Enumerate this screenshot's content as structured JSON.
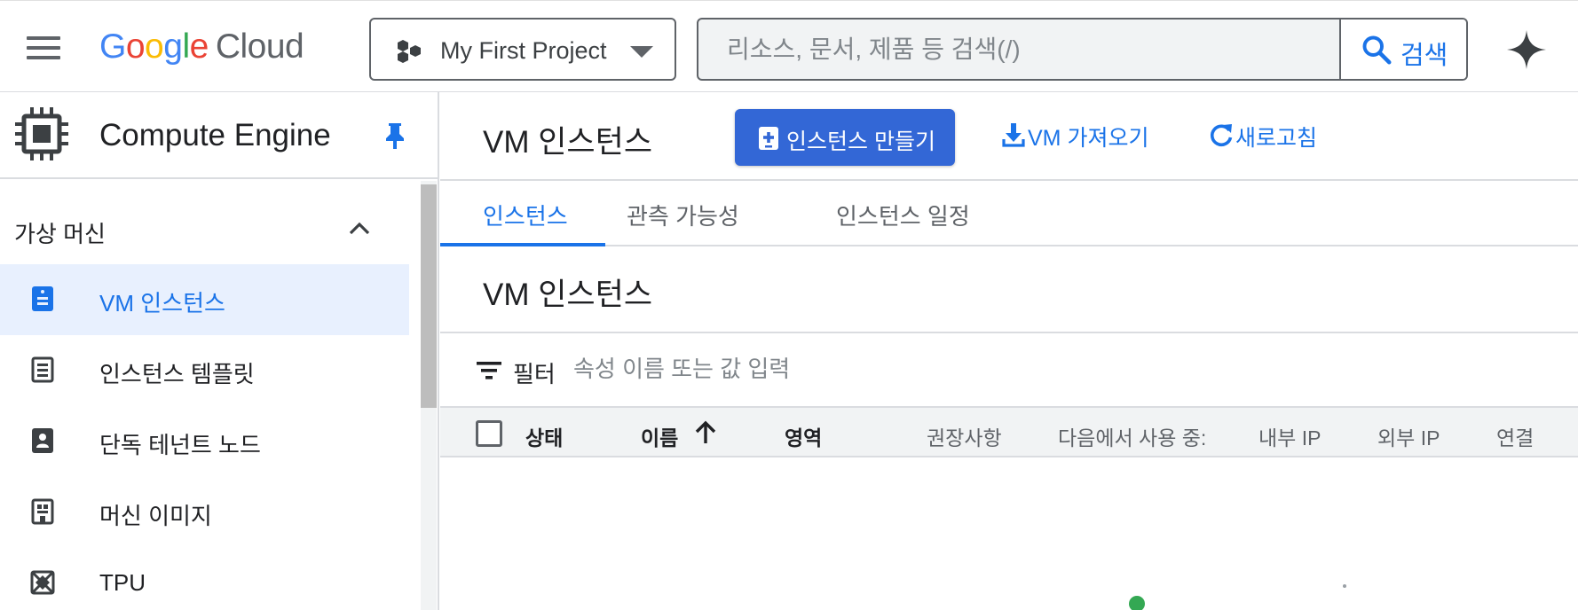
{
  "header": {
    "logo_google": [
      "G",
      "o",
      "o",
      "g",
      "l",
      "e"
    ],
    "logo_cloud": "Cloud",
    "project": "My First Project",
    "search_placeholder": "리소스, 문서, 제품 등 검색(/)",
    "search_button": "검색"
  },
  "sidebar": {
    "product_title": "Compute Engine",
    "section": "가상 머신",
    "items": [
      {
        "label": "VM 인스턴스",
        "icon": "vm-instance-icon",
        "active": true
      },
      {
        "label": "인스턴스 템플릿",
        "icon": "template-icon",
        "active": false
      },
      {
        "label": "단독 테넌트 노드",
        "icon": "sole-tenant-node-icon",
        "active": false
      },
      {
        "label": "머신 이미지",
        "icon": "machine-image-icon",
        "active": false
      },
      {
        "label": "TPU",
        "icon": "tpu-icon",
        "active": false
      }
    ]
  },
  "main": {
    "page_title": "VM 인스턴스",
    "create_button": "인스턴스 만들기",
    "import_button": "VM 가져오기",
    "refresh_button": "새로고침",
    "tabs": [
      "인스턴스",
      "관측 가능성",
      "인스턴스 일정"
    ],
    "active_tab": 0,
    "section_title": "VM 인스턴스",
    "filter_label": "필터",
    "filter_placeholder": "속성 이름 또는 값 입력",
    "columns": [
      "상태",
      "이름",
      "영역",
      "권장사항",
      "다음에서 사용 중:",
      "내부 IP",
      "외부 IP",
      "연결"
    ]
  },
  "colors": {
    "accent": "#1a73e8",
    "primary_button": "#3367d6",
    "active_nav_bg": "#e8f0fe",
    "loading_green": "#34a853"
  }
}
